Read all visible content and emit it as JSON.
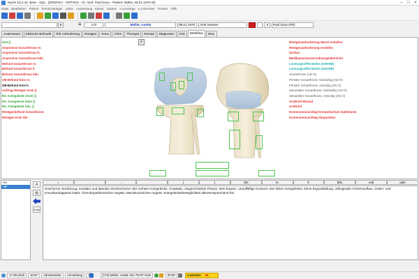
{
  "window": {
    "title": "Isynet 18.4.43 .Beta - SQL - [ERDOKU - ORTHO1 - Dr. med. Paul Doxx - Patient: Müller, 08.01.1978 W]",
    "buttons": [
      "–",
      "□",
      "×"
    ]
  },
  "menu": [
    "Datei",
    "Bearbeiten",
    "Patient",
    "Terminmanager",
    "Labor",
    "Auswertung",
    "Extras",
    "System",
    "x.concierge",
    "x.comcenter",
    "Fenster",
    "Hilfe"
  ],
  "toolbar": {
    "icons": [
      {
        "name": "new-icon",
        "color": "#2f6fcf"
      },
      {
        "name": "patient-icon",
        "color": "#d04040"
      },
      {
        "name": "save-icon",
        "color": "#2f6fcf"
      },
      {
        "name": "print-icon",
        "color": "#777777"
      },
      {
        "name": "calendar-icon",
        "color": "#e0a020"
      },
      {
        "name": "lab-icon",
        "color": "#3aa03a"
      },
      {
        "name": "letter-icon",
        "color": "#2f6fcf"
      },
      {
        "name": "fax-icon",
        "color": "#555555"
      },
      {
        "name": "mail-icon",
        "color": "#e0a020"
      },
      {
        "name": "chart-icon",
        "color": "#3aa03a"
      },
      {
        "name": "scan-icon",
        "color": "#777777"
      },
      {
        "name": "invoice-icon",
        "color": "#d04040"
      },
      {
        "name": "calc-icon",
        "color": "#2f6fcf"
      },
      {
        "name": "tool-icon",
        "color": "#777777"
      },
      {
        "name": "phone-icon",
        "color": "#3aa03a"
      },
      {
        "name": "help-icon",
        "color": "#2f6fcf"
      }
    ]
  },
  "patient_bar": {
    "number": "172",
    "name": "Müller, Anette",
    "dob": "08.01.1978",
    "insurance": "AOK Hessen",
    "euro": "€",
    "doctor": "Paul Doxx (PD)"
  },
  "tabs": [
    "Anamnesen",
    "Klinische Befunde",
    "RÖ-Anforderung",
    "Röntgen",
    "Sono",
    "Chiro",
    "Therapie",
    "Rezept",
    "Diagnosen",
    "ICD",
    "Workflow",
    "IGeL"
  ],
  "active_tab": "Workflow",
  "left_list": [
    {
      "label": "Seit ()",
      "color": "green"
    },
    {
      "label": "Anamnese Gonarthrose re.",
      "color": "red"
    },
    {
      "label": "Anamnese Gonarthrose li.",
      "color": "red"
    },
    {
      "label": "Anamnese Gonarthrose bds.",
      "color": "red"
    },
    {
      "label": "Befund Gonarthrose re.",
      "color": "red"
    },
    {
      "label": "Befund Gonarthrose li.",
      "color": "red"
    },
    {
      "label": "Befund Gonarthrose bds.",
      "color": "red"
    },
    {
      "label": "OB-Befund Knie re.",
      "color": "red"
    },
    {
      "label": "OB-Befund Knie li.",
      "color": "black"
    },
    {
      "label": "Auftrag Röntgen Knie ()",
      "color": "red"
    },
    {
      "label": "Rö. Kniegelenk re/cht ()",
      "color": "green"
    },
    {
      "label": "Rö. Kniegelenk links ()",
      "color": "green"
    },
    {
      "label": "Rö. Kniegelenk bds. ()",
      "color": "green"
    },
    {
      "label": "Röntgenbefund Gonarthrose",
      "color": "red"
    },
    {
      "label": "Röntgen Knie OD",
      "color": "red"
    }
  ],
  "right_list": [
    {
      "label": "Röntgenanforderung Wurst erstellen",
      "color": "red"
    },
    {
      "label": "Röntgenanforderung erstellen",
      "color": "red"
    },
    {
      "label": "Scribor",
      "color": "red"
    },
    {
      "label": "Medikamentenverordnungsübersicht",
      "color": "red"
    },
    {
      "label": "Leistungsziffernkette (XOKRB)",
      "color": "cyan"
    },
    {
      "label": "Leistungsziffernkette (XOKRB)",
      "color": "cyan"
    },
    {
      "label": "Gonarthrose (AD G)",
      "color": "gray"
    },
    {
      "label": "Primäre Gonarthrose, beidseitig (AD G)",
      "color": "gray"
    },
    {
      "label": "Primäre Gonarthrose, einseitig (AD G)",
      "color": "gray"
    },
    {
      "label": "Sekundäre Gonarthrose, beidseitig (AD G)",
      "color": "gray"
    },
    {
      "label": "Sekundäre Gonarthrose, einseitig (AD G)",
      "color": "gray"
    },
    {
      "label": "Arztbrief Wound",
      "color": "red"
    },
    {
      "label": "Arztbrief",
      "color": "red"
    },
    {
      "label": "Kostenvoranschlag Knorpelschutz Injektionen",
      "color": "red"
    },
    {
      "label": "Kostenvoranschlag Akupunktur",
      "color": "red"
    }
  ],
  "bottom_left_list": [
    {
      "label": "AA",
      "selected": false
    },
    {
      "label": "AB",
      "selected": true
    }
  ],
  "side_buttons": [
    {
      "name": "format-icon",
      "label": "A"
    },
    {
      "name": "text-icon",
      "label": "▤"
    },
    {
      "name": "blue-arrow-icon",
      "label": ""
    },
    {
      "name": "undo-icon",
      "label": "Undo"
    }
  ],
  "phrase_buttons": [
    "=",
    ".",
    ",",
    "-",
    "(",
    ")",
    "DD",
    "re.",
    "li.",
    "bds.",
    "und",
    "oder"
  ],
  "body_text": "Knöcherne Verdickung, medialer und lateraler Druckschmerz des rechten Kniegelenks. Crepitatio, eingeschränkte Flexion, kein Erguss. Unauffällige Konturen des linken Kniegelenks, keine Ergussbildung, orthograder Achsenaufbau. Seiten- und Kreuzbandapparat intakt. Chondropathiezeichen negativ. Meniskuszeichen negativ. Kniegelenksbeweglichkeit altersentsprechend frei.",
  "status": {
    "date": "17.08.2018",
    "time": "10:57",
    "user": "Administrator",
    "mode": "Anmeldung",
    "count": "1",
    "patient": "[172] Müller, Anette 40J 7M 9T NJN",
    "clock": "00:00",
    "service_label": "x.service:",
    "service_count": "15"
  }
}
